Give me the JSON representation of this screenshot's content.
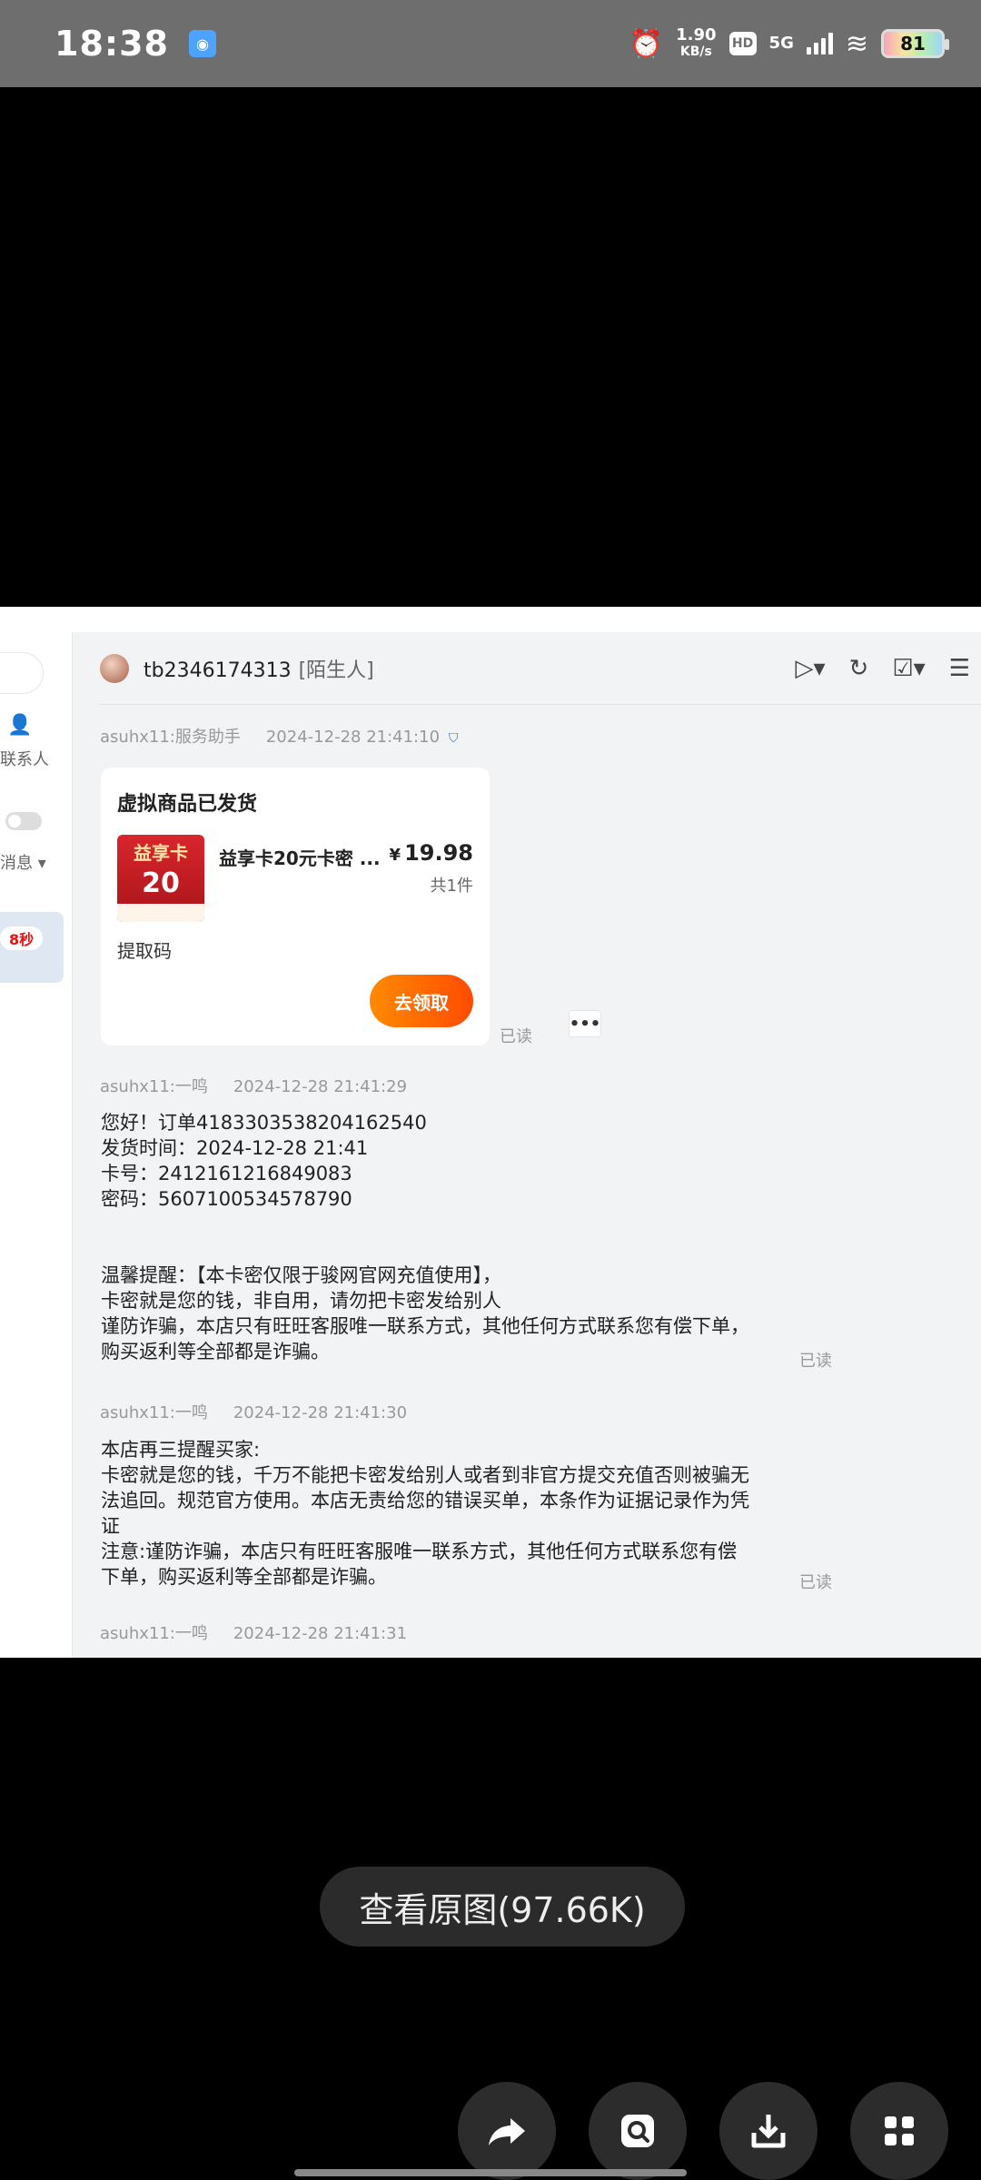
{
  "status_bar": {
    "time": "18:38",
    "net_speed_value": "1.90",
    "net_speed_unit": "KB/s",
    "hd": "HD",
    "network": "5G",
    "battery": "81"
  },
  "shot": {
    "left_panel": {
      "contacts_label": "联系人",
      "messages_label": "消息 ▾",
      "badge": "8秒"
    },
    "header": {
      "contact_id": "tb2346174313",
      "contact_tag": "[陌生人]"
    },
    "card_meta": {
      "sender": "asuhx11:服务助手",
      "time": "2024-12-28 21:41:10"
    },
    "card": {
      "title": "虚拟商品已发货",
      "thumb_line1": "益享卡",
      "thumb_line2": "20",
      "product_name": "益享卡20元卡密 ...",
      "currency": "¥",
      "price": "19.98",
      "quantity": "共1件",
      "code_label": "提取码",
      "claim_button": "去领取",
      "read": "已读"
    },
    "messages": [
      {
        "sender": "asuhx11:一鸣",
        "time": "2024-12-28 21:41:29",
        "text": "您好！订单4183303538204162540\n发货时间：2024-12-28 21:41\n卡号：2412161216849083\n密码：5607100534578790\n\n\n温馨提醒：【本卡密仅限于骏网官网充值使用】，\n卡密就是您的钱，非自用，请勿把卡密发给别人\n谨防诈骗，本店只有旺旺客服唯一联系方式，其他任何方式联系您有偿下单，\n购买返利等全部都是诈骗。",
        "read": "已读"
      },
      {
        "sender": "asuhx11:一鸣",
        "time": "2024-12-28 21:41:30",
        "text": "本店再三提醒买家:\n卡密就是您的钱，千万不能把卡密发给别人或者到非官方提交充值否则被骗无\n法追回。规范官方使用。本店无责给您的错误买单，本条作为证据记录作为凭\n证\n注意:谨防诈骗，本店只有旺旺客服唯一联系方式，其他任何方式联系您有偿\n下单，购买返利等全部都是诈骗。",
        "read": "已读"
      },
      {
        "sender": "asuhx11:一鸣",
        "time": "2024-12-28 21:41:31"
      }
    ]
  },
  "viewer": {
    "view_original_label": "查看原图(97.66K)"
  },
  "icons": {
    "share": "share-icon",
    "search": "search-image-icon",
    "download": "download-icon",
    "more": "grid-icon"
  }
}
